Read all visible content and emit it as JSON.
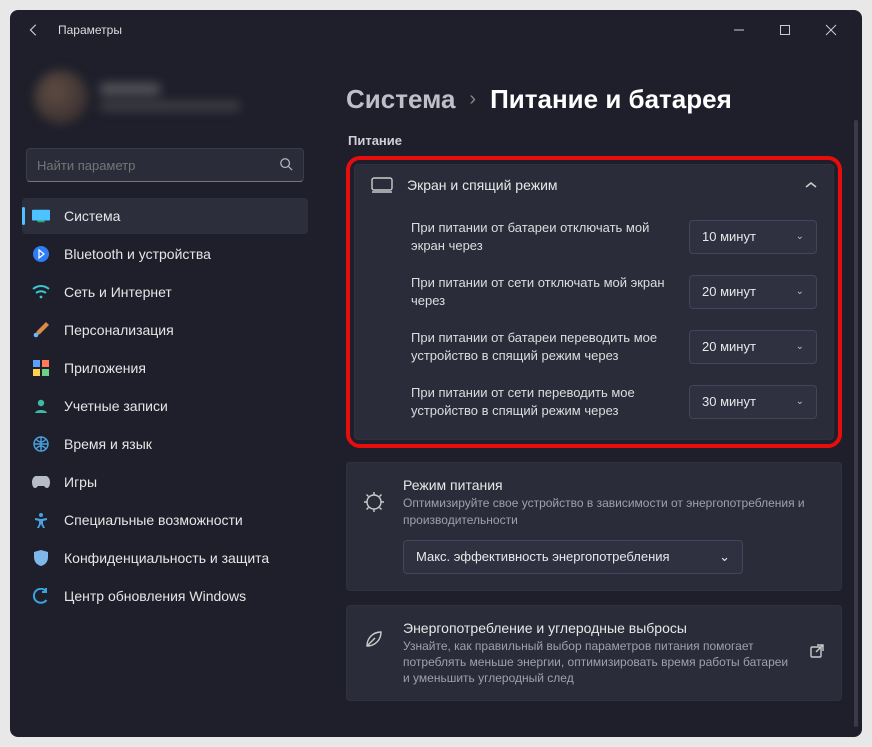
{
  "app_title": "Параметры",
  "search": {
    "placeholder": "Найти параметр"
  },
  "nav": [
    {
      "key": "system",
      "label": "Система",
      "active": true
    },
    {
      "key": "bluetooth",
      "label": "Bluetooth и устройства"
    },
    {
      "key": "network",
      "label": "Сеть и Интернет"
    },
    {
      "key": "personalization",
      "label": "Персонализация"
    },
    {
      "key": "apps",
      "label": "Приложения"
    },
    {
      "key": "accounts",
      "label": "Учетные записи"
    },
    {
      "key": "time",
      "label": "Время и язык"
    },
    {
      "key": "games",
      "label": "Игры"
    },
    {
      "key": "accessibility",
      "label": "Специальные возможности"
    },
    {
      "key": "privacy",
      "label": "Конфиденциальность и защита"
    },
    {
      "key": "update",
      "label": "Центр обновления Windows"
    }
  ],
  "breadcrumb": {
    "parent": "Система",
    "current": "Питание и батарея"
  },
  "section_power_label": "Питание",
  "screen_sleep": {
    "title": "Экран и спящий режим",
    "rows": [
      {
        "label": "При питании от батареи отключать мой экран через",
        "value": "10 минут"
      },
      {
        "label": "При питании от сети отключать мой экран через",
        "value": "20 минут"
      },
      {
        "label": "При питании от батареи переводить мое устройство в спящий режим через",
        "value": "20 минут"
      },
      {
        "label": "При питании от сети переводить мое устройство в спящий режим через",
        "value": "30 минут"
      }
    ]
  },
  "power_mode": {
    "title": "Режим питания",
    "desc": "Оптимизируйте свое устройство в зависимости от энергопотребления и производительности",
    "value": "Макс. эффективность энергопотребления"
  },
  "energy": {
    "title": "Энергопотребление и углеродные выбросы",
    "desc": "Узнайте, как правильный выбор параметров питания помогает потреблять меньше энергии, оптимизировать время работы батареи и уменьшить углеродный след"
  }
}
